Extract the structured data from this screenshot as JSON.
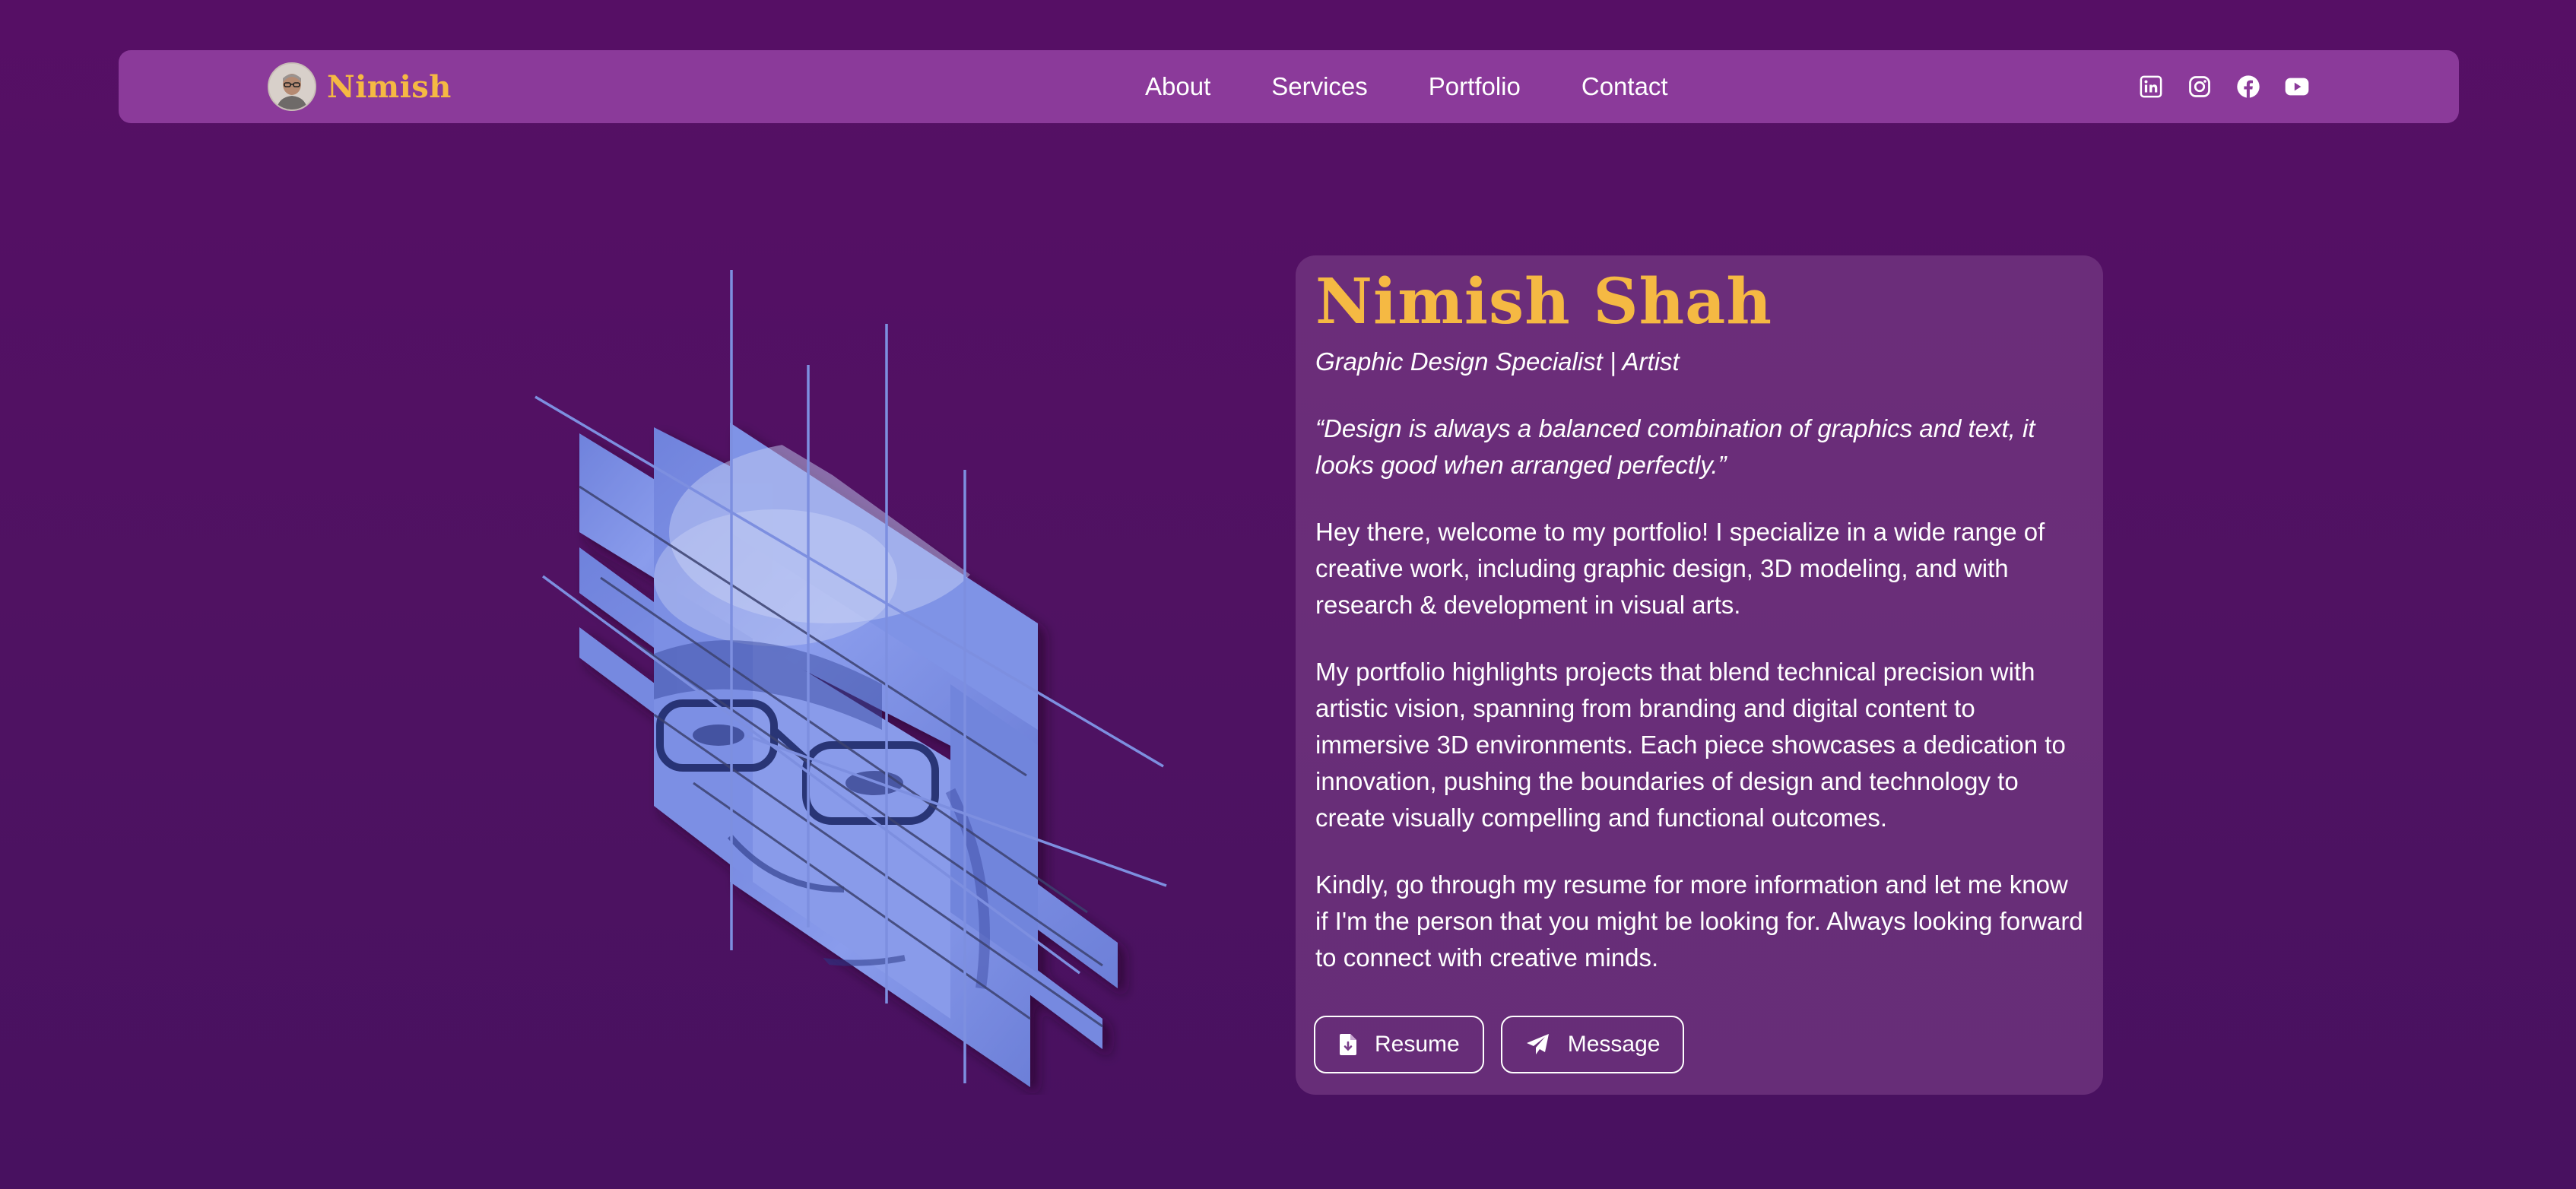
{
  "navbar": {
    "brand": "Nimish",
    "links": [
      "About",
      "Services",
      "Portfolio",
      "Contact"
    ],
    "social_icons": [
      "linkedin-icon",
      "instagram-icon",
      "facebook-icon",
      "youtube-icon"
    ]
  },
  "profile": {
    "name": "Nimish Shah",
    "role": "Graphic Design Specialist | Artist",
    "quote": "“Design is always a balanced combination of graphics and text, it looks good when arranged perfectly.”",
    "paragraphs": [
      "Hey there, welcome to my portfolio! I specialize in a wide range of creative work, including graphic design, 3D modeling, and with research & development in visual arts.",
      "My portfolio highlights projects that blend technical precision with artistic vision, spanning from branding and digital content to immersive 3D environments. Each piece showcases a dedication to innovation, pushing the boundaries of design and technology to create visually compelling and functional outcomes.",
      "Kindly, go through my resume for more information and let me know if I'm the person that you might be looking for. Always looking forward to connect with creative minds."
    ],
    "buttons": {
      "resume": "Resume",
      "message": "Message"
    }
  },
  "colors": {
    "background": "#560f65",
    "navbar": "#8b3a9a",
    "accent": "#f5b943",
    "card": "#7a3e8a",
    "art_tint": "#7b8ee6"
  }
}
